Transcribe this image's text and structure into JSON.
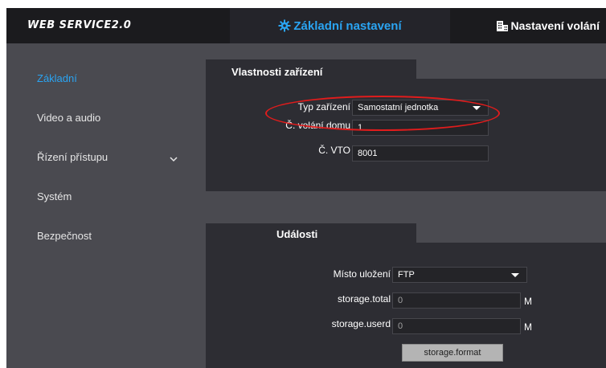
{
  "header": {
    "logo": "WEB SERVICE2.0",
    "tab_basic": "Základní nastavení",
    "tab_call": "Nastavení volání"
  },
  "sidebar": {
    "items": [
      {
        "label": "Základní",
        "active": true
      },
      {
        "label": "Video a audio"
      },
      {
        "label": "Řízení přístupu",
        "expandable": true
      },
      {
        "label": "Systém"
      },
      {
        "label": "Bezpečnost"
      }
    ]
  },
  "device_properties": {
    "title": "Vlastnosti zařízení",
    "device_type_label": "Typ zařízení",
    "device_type_value": "Samostatní jednotka",
    "room_no_label": "Č. volání domu",
    "room_no_value": "1",
    "vto_no_label": "Č. VTO",
    "vto_no_value": "8001"
  },
  "events": {
    "title": "Události",
    "storage_location_label": "Místo uložení",
    "storage_location_value": "FTP",
    "storage_total_label": "storage.total",
    "storage_total_value": "0",
    "storage_total_unit": "M",
    "storage_used_label": "storage.userd",
    "storage_used_value": "0",
    "storage_used_unit": "M",
    "format_button": "storage.format"
  },
  "colors": {
    "accent": "#2aa4f2",
    "highlight": "#e11c1c",
    "panel": "#2d2d33",
    "background": "#4a4a50"
  }
}
